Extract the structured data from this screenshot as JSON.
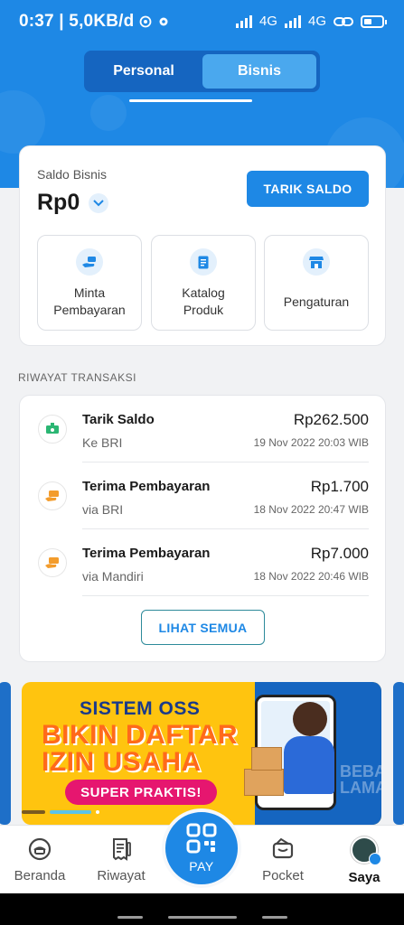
{
  "status_bar": {
    "time_speed": "0:37 | 5,0KB/d",
    "network1": "4G",
    "network2": "4G"
  },
  "account_tabs": [
    {
      "label": "Personal",
      "active": false
    },
    {
      "label": "Bisnis",
      "active": true
    }
  ],
  "saldo": {
    "label": "Saldo Bisnis",
    "value": "Rp0",
    "withdraw_button": "TARIK SALDO"
  },
  "quick_menu": [
    {
      "label": "Minta\nPembayaran",
      "icon": "money-hand-icon"
    },
    {
      "label": "Katalog\nProduk",
      "icon": "document-icon"
    },
    {
      "label": "Pengaturan",
      "icon": "store-icon"
    }
  ],
  "history": {
    "section_title": "RIWAYAT TRANSAKSI",
    "items": [
      {
        "title": "Tarik Saldo",
        "subtitle": "Ke BRI",
        "amount": "Rp262.500",
        "date": "19 Nov 2022 20:03 WIB",
        "icon": "withdraw-icon",
        "icon_color": "#2bb673"
      },
      {
        "title": "Terima Pembayaran",
        "subtitle": "via BRI",
        "amount": "Rp1.700",
        "date": "18 Nov 2022 20:47 WIB",
        "icon": "receive-payment-icon",
        "icon_color": "#f39c2c"
      },
      {
        "title": "Terima Pembayaran",
        "subtitle": "via Mandiri",
        "amount": "Rp7.000",
        "date": "18 Nov 2022 20:46 WIB",
        "icon": "receive-payment-icon",
        "icon_color": "#f39c2c"
      }
    ],
    "see_all_button": "LIHAT SEMUA"
  },
  "banner": {
    "line1": "SISTEM OSS",
    "line2": "BIKIN DAFTAR",
    "line3": "IZIN USAHA",
    "pill": "SUPER PRAKTIS!",
    "watermark": "BEBAS\nLAMA"
  },
  "bottom_nav": [
    {
      "label": "Beranda",
      "icon": "home-chat-icon"
    },
    {
      "label": "Riwayat",
      "icon": "receipt-icon"
    },
    {
      "label": "PAY",
      "icon": "qr-code-icon"
    },
    {
      "label": "Pocket",
      "icon": "wallet-icon"
    },
    {
      "label": "Saya",
      "icon": "avatar-icon",
      "active": true
    }
  ],
  "colors": {
    "primary": "#1e88e5",
    "primary_dark": "#1565c0",
    "success": "#2bb673",
    "warning": "#f39c2c"
  }
}
